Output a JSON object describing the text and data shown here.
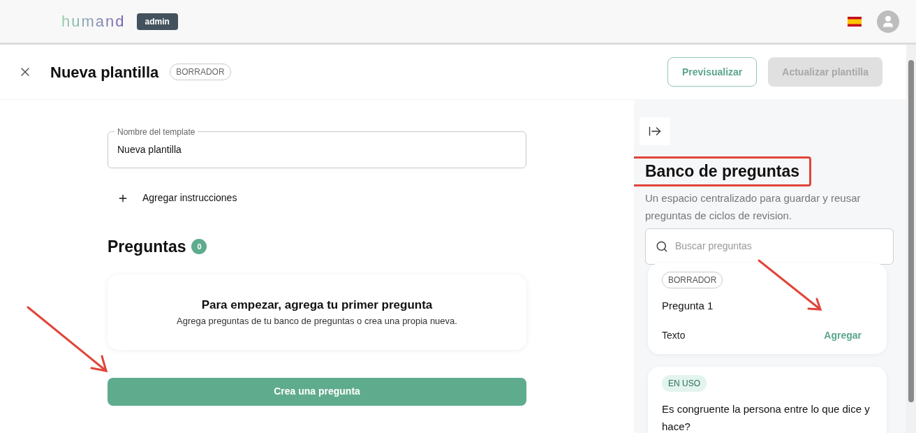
{
  "header": {
    "logo": "humand",
    "role_badge": "admin"
  },
  "title_bar": {
    "title": "Nueva plantilla",
    "status": "BORRADOR",
    "buttons": [
      {
        "label": "Previsualizar",
        "disabled": false
      },
      {
        "label": "Actualizar plantilla",
        "disabled": true
      }
    ]
  },
  "form": {
    "name_field": {
      "label": "Nombre del template",
      "value": "Nueva plantilla"
    },
    "add_instructions": "Agregar instrucciones"
  },
  "questions": {
    "title": "Preguntas",
    "count": "0",
    "empty_title": "Para empezar, agrega tu primer pregunta",
    "empty_text": "Agrega preguntas de tu banco de preguntas o crea una propia nueva.",
    "create_button": "Crea una pregunta"
  },
  "question_bank": {
    "title": "Banco de preguntas",
    "description": "Un espacio centralizado para guardar y reusar preguntas de ciclos de revision.",
    "search": {
      "placeholder": "Buscar preguntas"
    },
    "items": [
      {
        "status": "BORRADOR",
        "kind": "draft",
        "question": "Pregunta 1",
        "type": "Texto",
        "action": "Agregar"
      },
      {
        "status": "EN USO",
        "kind": "in_use",
        "question": "Es congruente la persona entre lo que dice y hace?"
      }
    ]
  }
}
